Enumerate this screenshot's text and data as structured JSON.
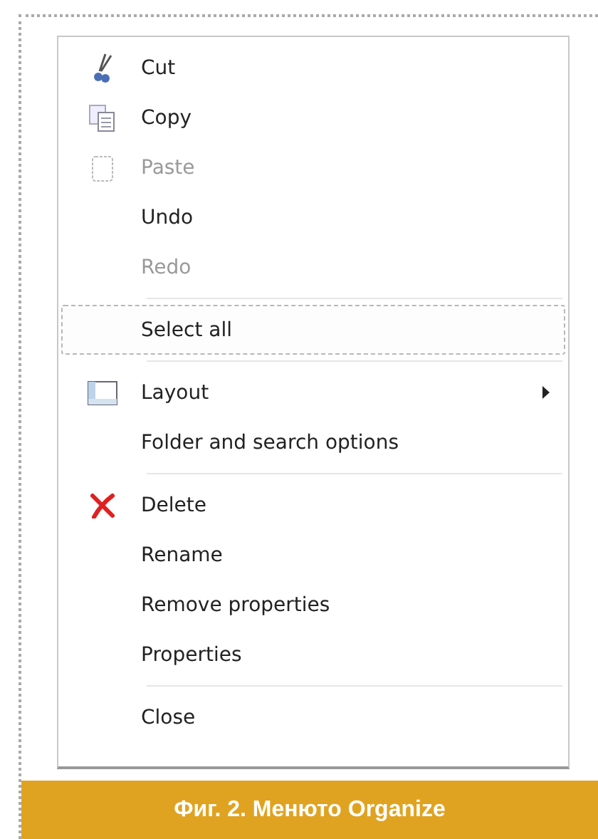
{
  "menu": {
    "groups": [
      {
        "items": [
          {
            "label": "Cut",
            "disabled": false,
            "selected": false,
            "submenu": false
          },
          {
            "label": "Copy",
            "disabled": false,
            "selected": false,
            "submenu": false
          },
          {
            "label": "Paste",
            "disabled": true,
            "selected": false,
            "submenu": false
          },
          {
            "label": "Undo",
            "disabled": false,
            "selected": false,
            "submenu": false
          },
          {
            "label": "Redo",
            "disabled": true,
            "selected": false,
            "submenu": false
          }
        ]
      },
      {
        "items": [
          {
            "label": "Select all",
            "disabled": false,
            "selected": true,
            "submenu": false
          }
        ]
      },
      {
        "items": [
          {
            "label": "Layout",
            "disabled": false,
            "selected": false,
            "submenu": true
          },
          {
            "label": "Folder and search options",
            "disabled": false,
            "selected": false,
            "submenu": false
          }
        ]
      },
      {
        "items": [
          {
            "label": "Delete",
            "disabled": false,
            "selected": false,
            "submenu": false
          },
          {
            "label": "Rename",
            "disabled": false,
            "selected": false,
            "submenu": false
          },
          {
            "label": "Remove properties",
            "disabled": false,
            "selected": false,
            "submenu": false
          },
          {
            "label": "Properties",
            "disabled": false,
            "selected": false,
            "submenu": false
          }
        ]
      },
      {
        "items": [
          {
            "label": "Close",
            "disabled": false,
            "selected": false,
            "submenu": false
          }
        ]
      }
    ]
  },
  "caption": "Фиг. 2. Менюто Organize"
}
